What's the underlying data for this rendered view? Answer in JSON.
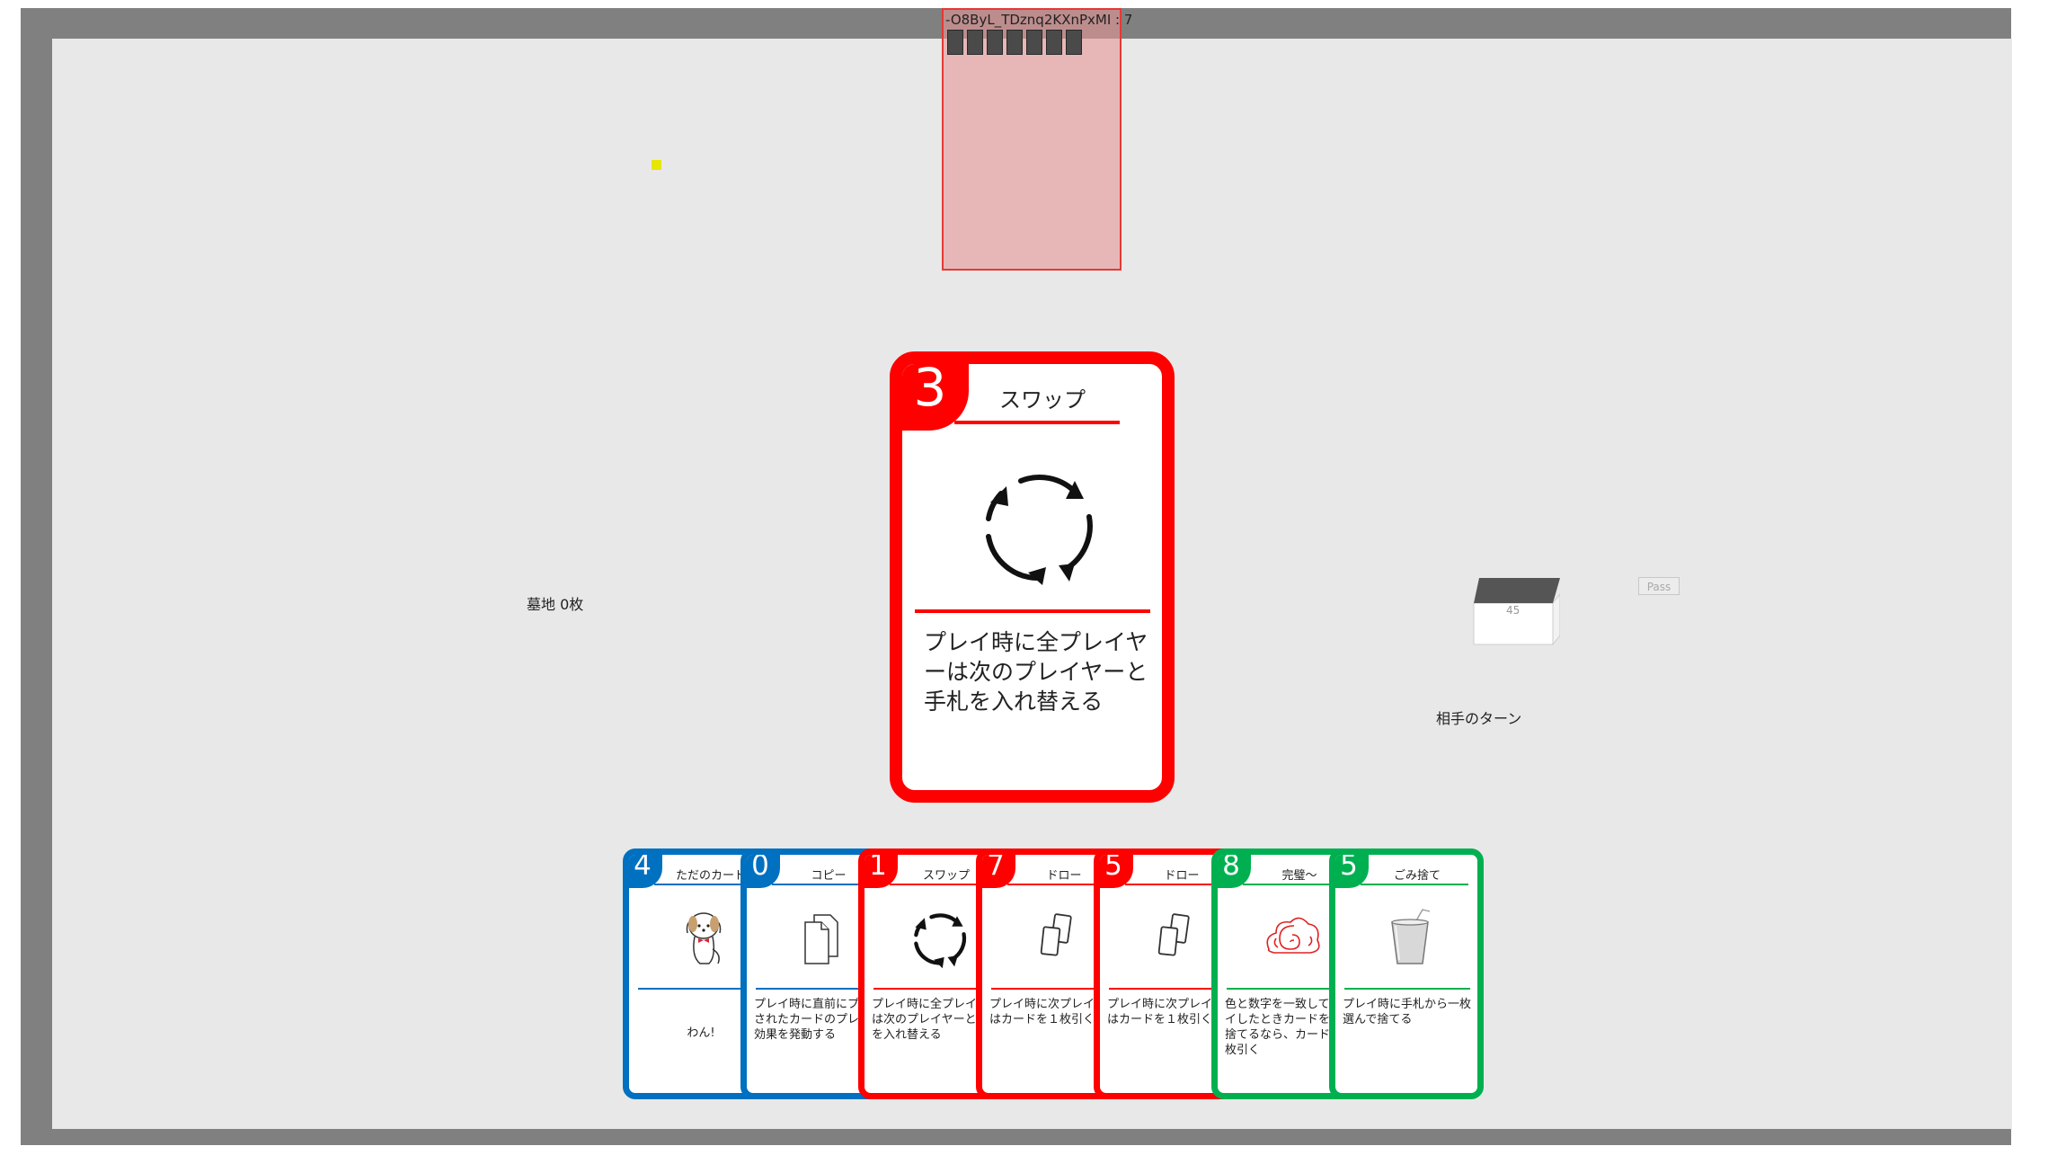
{
  "opponent": {
    "label": "-O8ByL_TDznq2KXnPxMI : 7",
    "card_back_count": 7
  },
  "graveyard": {
    "label": "墓地 0枚"
  },
  "deck": {
    "count": "45"
  },
  "controls": {
    "pass_label": "Pass"
  },
  "status": {
    "turn_text": "相手のターン"
  },
  "played_card": {
    "number": "3",
    "title": "スワップ",
    "color": "#ff0000",
    "icon": "rotate-arrows-icon",
    "description": "プレイ時に全プレイヤーは次のプレイヤーと手札を入れ替える"
  },
  "hand": [
    {
      "number": "4",
      "title": "ただのカード",
      "color": "blue",
      "icon": "dog-icon",
      "description": "わん!"
    },
    {
      "number": "0",
      "title": "コピー",
      "color": "blue",
      "icon": "copy-icon",
      "description": "プレイ時に直前にプレイされたカードのプレイ時効果を発動する"
    },
    {
      "number": "1",
      "title": "スワップ",
      "color": "red",
      "icon": "rotate-arrows-icon",
      "description": "プレイ時に全プレイヤーは次のプレイヤーと手札を入れ替える"
    },
    {
      "number": "7",
      "title": "ドロー",
      "color": "red",
      "icon": "cards-icon",
      "description": "プレイ時に次プレイヤーはカードを１枚引く"
    },
    {
      "number": "5",
      "title": "ドロー",
      "color": "red",
      "icon": "cards-icon",
      "description": "プレイ時に次プレイヤーはカードを１枚引く"
    },
    {
      "number": "8",
      "title": "完璧～",
      "color": "green",
      "icon": "swirl-cloud-icon",
      "description": "色と数字を一致してプレイしたときカードを２枚捨てるなら、カードを１枚引く"
    },
    {
      "number": "5",
      "title": "ごみ捨て",
      "color": "green",
      "icon": "trash-cup-icon",
      "description": "プレイ時に手札から一枚選んで捨てる"
    }
  ],
  "colors": {
    "red": "#ff0000",
    "blue": "#0070c0",
    "green": "#00b050",
    "board": "#e8e8e8",
    "frame": "#808080"
  }
}
